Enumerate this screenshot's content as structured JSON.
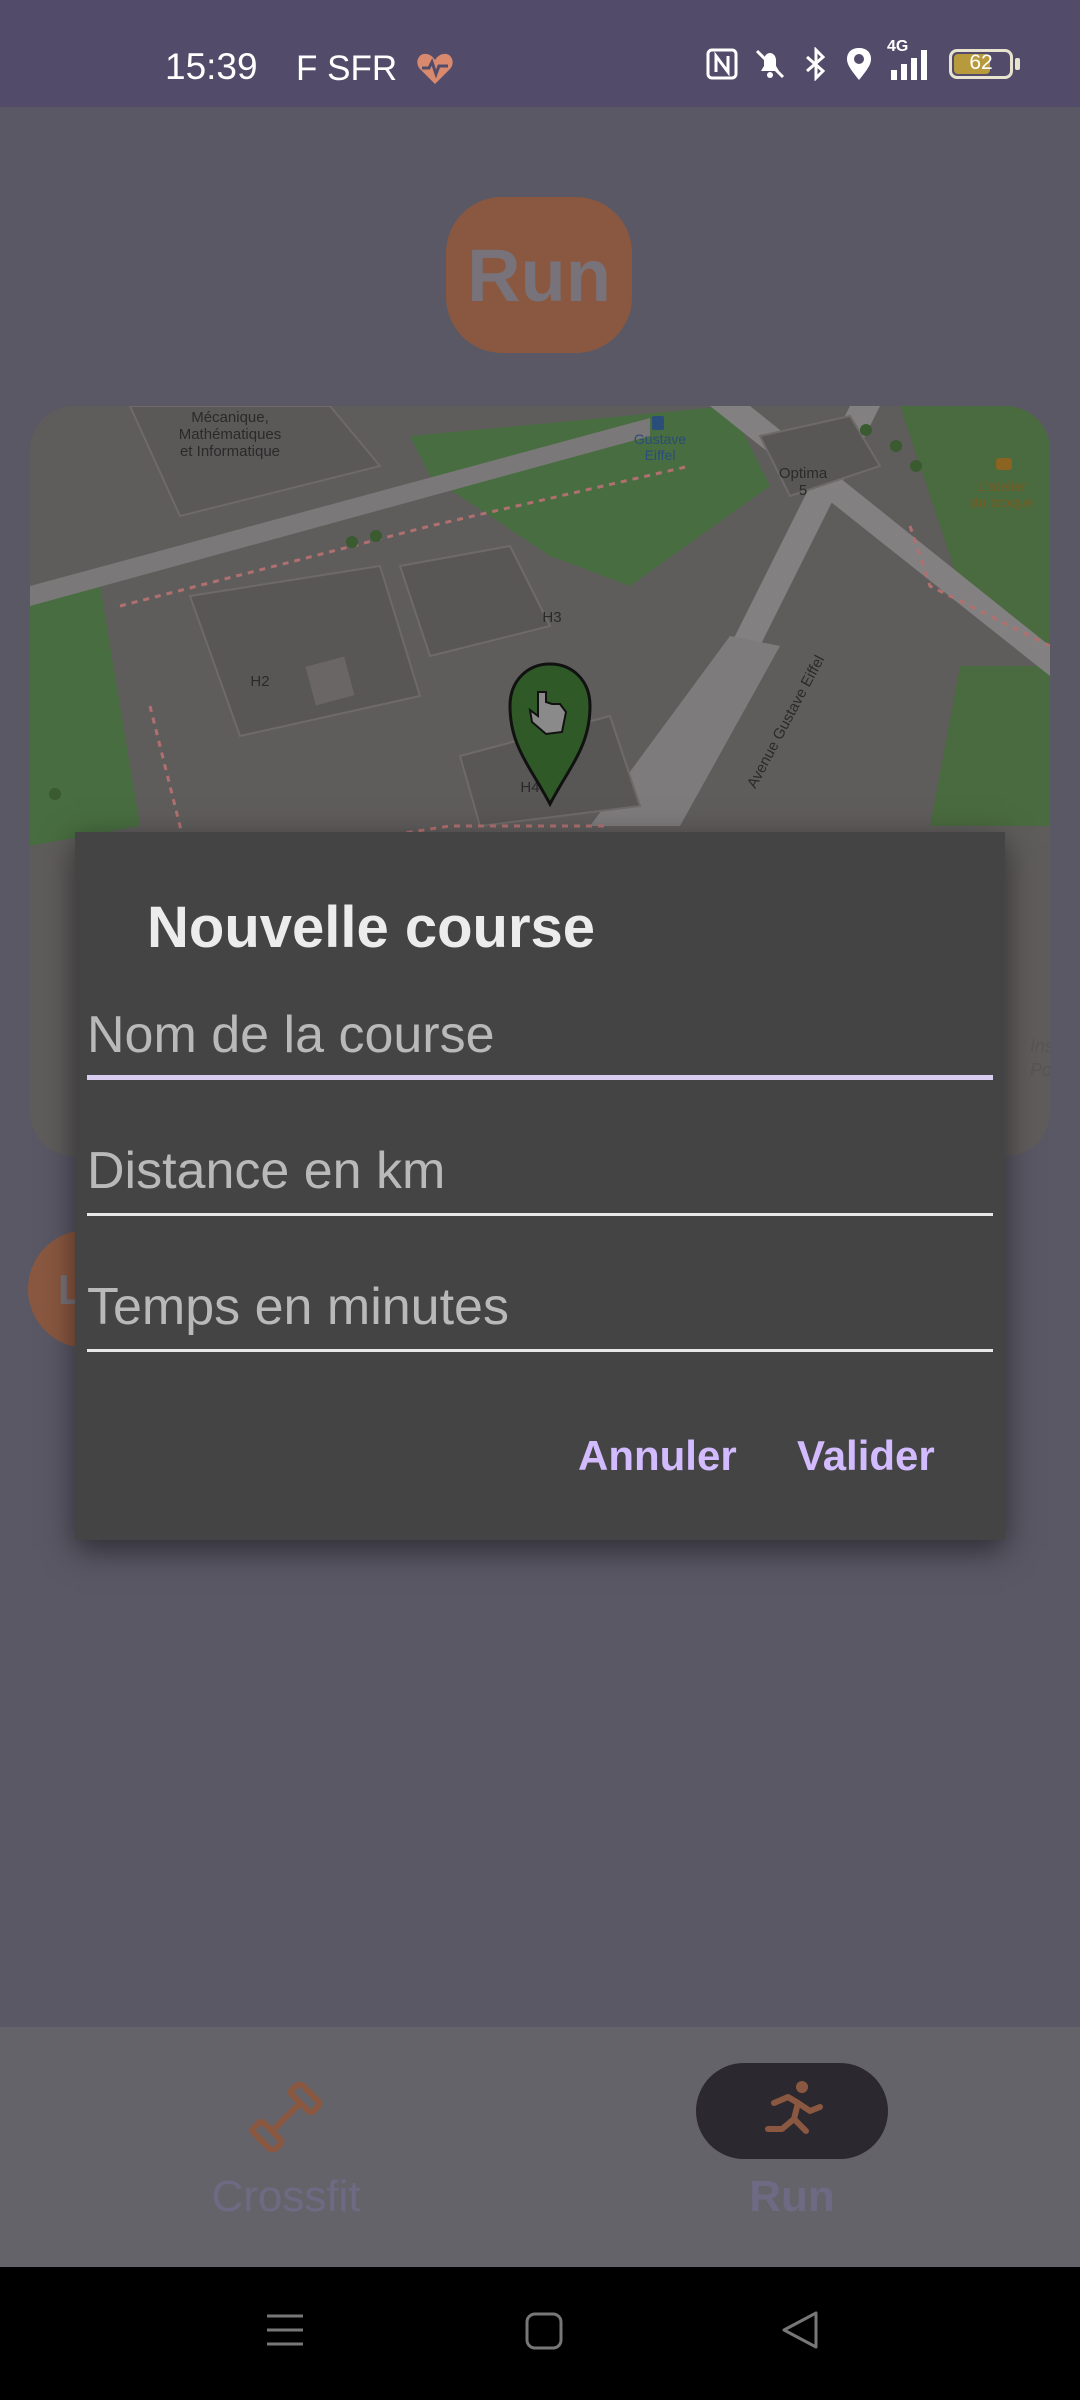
{
  "status_bar": {
    "time": "15:39",
    "carrier": "F SFR",
    "network": "4G",
    "battery": "62",
    "icons": [
      "heart-pulse-icon",
      "nfc-icon",
      "mute-icon",
      "bluetooth-icon",
      "location-icon",
      "signal-icon",
      "battery-icon"
    ]
  },
  "header": {
    "title": "Run"
  },
  "map": {
    "labels": {
      "mecanique_1": "Mécanique,",
      "mecanique_2": "Mathématiques",
      "mecanique_3": "et Informatique",
      "gustave_1": "Gustave",
      "gustave_2": "Eiffel",
      "optima_1": "Optima",
      "optima_2": "5",
      "atelier_1": "L'atelier",
      "atelier_2": "du croque",
      "h2": "H2",
      "h3": "H3",
      "h4": "H4",
      "avenue": "Avenue Gustave Eiffel",
      "institut_1": "Institut",
      "institut_2": "Pobuc"
    }
  },
  "partial_button": {
    "label": "L"
  },
  "dialog": {
    "title": "Nouvelle course",
    "fields": {
      "name": {
        "placeholder": "Nom de la course",
        "value": ""
      },
      "distance": {
        "placeholder": "Distance en km",
        "value": ""
      },
      "time": {
        "placeholder": "Temps en minutes",
        "value": ""
      }
    },
    "cancel_label": "Annuler",
    "confirm_label": "Valider"
  },
  "bottom_nav": {
    "items": [
      {
        "label": "Crossfit",
        "icon": "dumbbell-icon",
        "active": false
      },
      {
        "label": "Run",
        "icon": "runner-icon",
        "active": true
      }
    ]
  },
  "colors": {
    "accent": "#d3bbff",
    "brand_orange": "#8a5840",
    "dialog_bg": "#444444",
    "status_bar": "#524c6a"
  }
}
